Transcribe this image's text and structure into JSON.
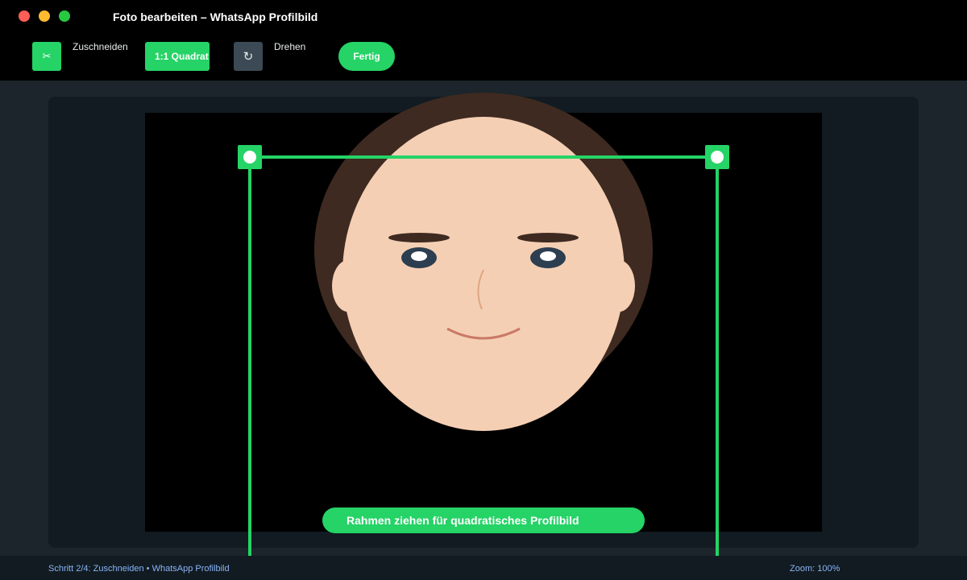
{
  "window": {
    "title": "Foto bearbeiten – WhatsApp Profilbild"
  },
  "toolbar": {
    "crop_icon": "scissors-icon",
    "crop_glyph": "✂",
    "crop_label": "Zuschneiden",
    "ratio_label": "1:1 Quadrat",
    "rotate_icon": "rotate-icon",
    "rotate_glyph": "↻",
    "rotate_label": "Drehen",
    "done_label": "Fertig"
  },
  "editor": {
    "hint": "Rahmen ziehen für quadratisches Profilbild"
  },
  "statusbar": {
    "step": "Schritt 2/4: Zuschneiden • WhatsApp Profilbild",
    "zoom": "Zoom: 100%"
  },
  "colors": {
    "accent": "#25d366",
    "background": "#1b252b",
    "panel": "#111b21",
    "status_text": "#8ab4f8"
  }
}
